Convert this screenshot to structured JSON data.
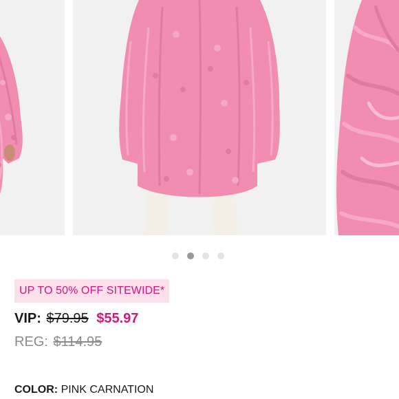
{
  "carousel": {
    "slide_count": 4,
    "active_slide": 2,
    "images": [
      "pink-coat-side-view",
      "pink-coat-back-view",
      "pink-coat-fur-closeup"
    ]
  },
  "product": {
    "promo_text": "UP TO 50% OFF SITEWIDE*",
    "vip_label": "VIP:",
    "vip_original_price": "$79.95",
    "vip_sale_price": "$55.97",
    "reg_label": "REG:",
    "reg_price": "$114.95",
    "color_label": "COLOR:",
    "color_value": "PINK CARNATION"
  },
  "colors": {
    "accent": "#d6167b",
    "promo_background": "#fbe0ec",
    "coat_pink": "#f08db1",
    "image_background": "#f1f1f2"
  }
}
